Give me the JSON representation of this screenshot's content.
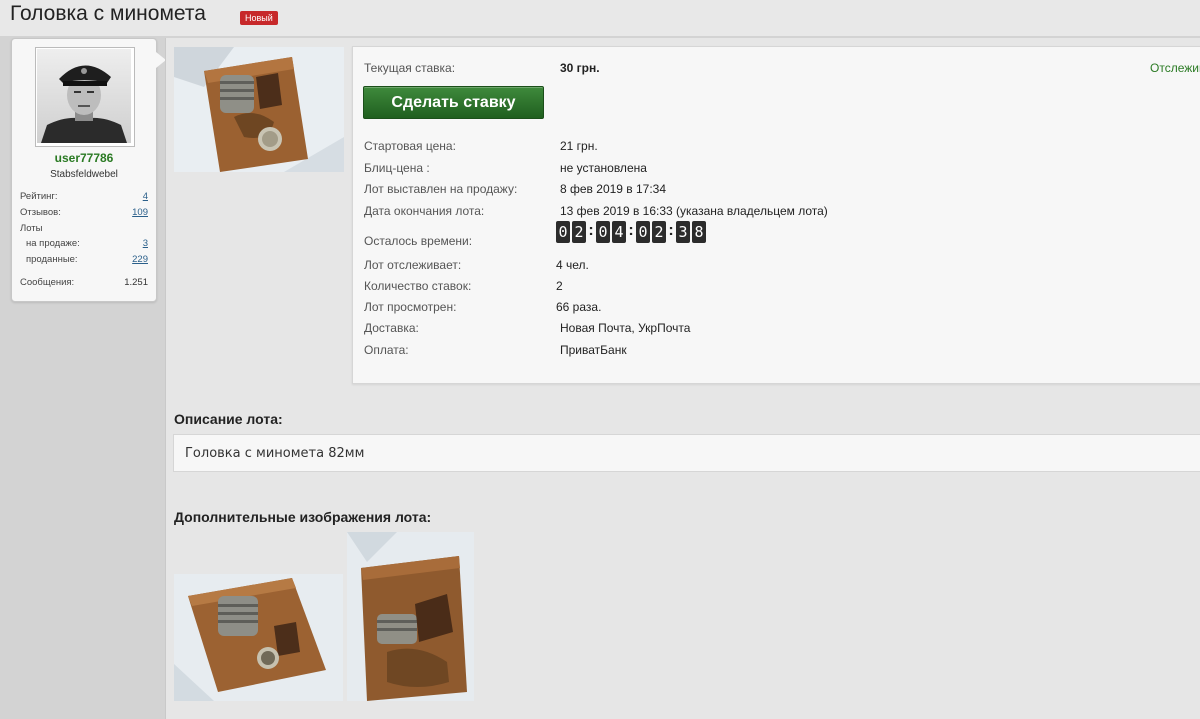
{
  "page": {
    "title": "Головка с миномета",
    "badge": "Новый"
  },
  "user": {
    "name": "user77786",
    "title": "Stabsfeldwebel",
    "stats": {
      "rating_label": "Рейтинг:",
      "rating_value": "4",
      "reviews_label": "Отзывов:",
      "reviews_value": "109",
      "lots_label": "Лоты",
      "on_sale_label": "на продаже:",
      "on_sale_value": "3",
      "sold_label": "проданные:",
      "sold_value": "229",
      "messages_label": "Сообщения:",
      "messages_value": "1.251"
    }
  },
  "lot": {
    "current_bid_label": "Текущая ставка:",
    "current_bid_value": "30 грн.",
    "watch_link": "Отслеживать",
    "bid_button": "Сделать ставку",
    "rows": [
      {
        "label": "Стартовая цена:",
        "value": "21 грн."
      },
      {
        "label": "Блиц-цена :",
        "value": "не установлена"
      },
      {
        "label": "Лот выставлен на продажу:",
        "value": "8 фев 2019 в 17:34"
      },
      {
        "label": "Дата окончания лота:",
        "value": "13 фев 2019 в 16:33 (указана владельцем лота)"
      }
    ],
    "time_left_label": "Осталось времени:",
    "timer": [
      "0",
      "2",
      "0",
      "4",
      "0",
      "2",
      "3",
      "8"
    ],
    "rows2": [
      {
        "label": "Лот отслеживает:",
        "value": "4 чел."
      },
      {
        "label": "Количество ставок:",
        "value": "2"
      },
      {
        "label": "Лот просмотрен:",
        "value": "66 раза."
      },
      {
        "label": "Доставка:",
        "value": "Новая Почта, УкрПочта"
      },
      {
        "label": "Оплата:",
        "value": "ПриватБанк"
      }
    ]
  },
  "description": {
    "heading": "Описание лота:",
    "text": "Головка с миномета 82мм"
  },
  "extra_images": {
    "heading": "Дополнительные изображения лота:"
  },
  "colors": {
    "accent_green": "#2a7a23",
    "button_green": "#2f7a2c",
    "badge_red": "#c7282a"
  }
}
